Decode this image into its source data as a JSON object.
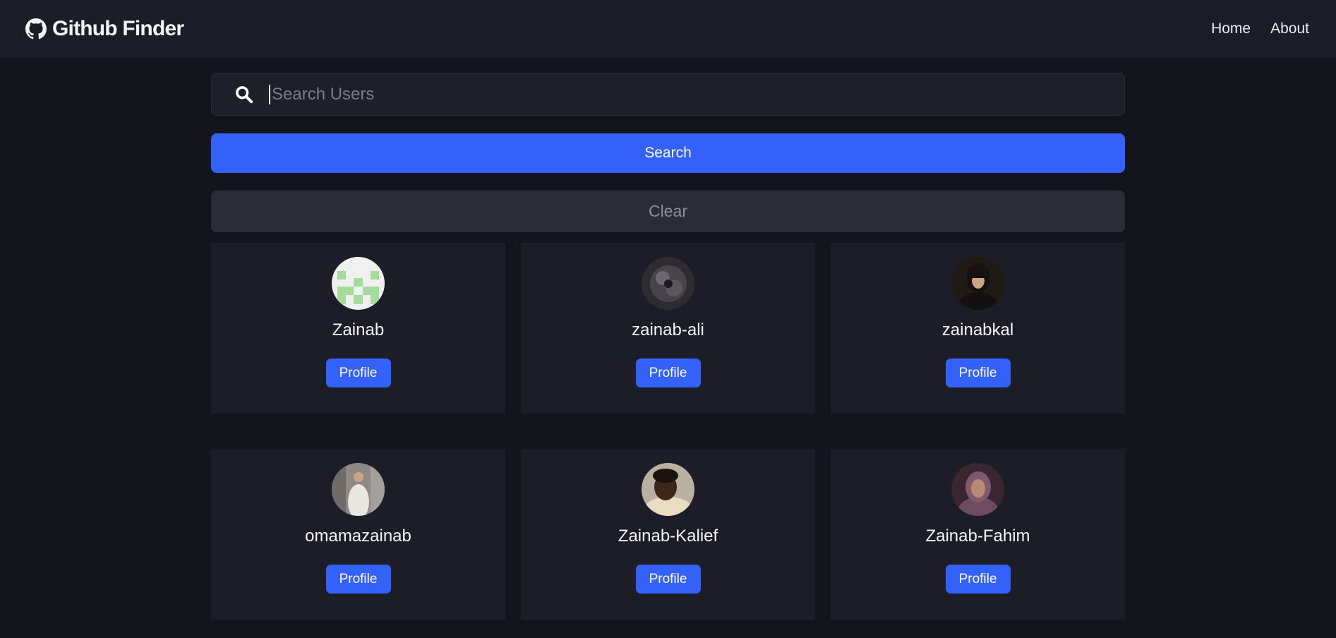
{
  "navbar": {
    "brand_icon": "github-icon",
    "brand_title": "Github Finder",
    "links": [
      "Home",
      "About"
    ]
  },
  "search": {
    "icon": "search-icon",
    "placeholder": "Search Users",
    "value": "",
    "search_label": "Search",
    "clear_label": "Clear"
  },
  "users": [
    {
      "login": "Zainab",
      "profile_label": "Profile"
    },
    {
      "login": "zainab-ali",
      "profile_label": "Profile"
    },
    {
      "login": "zainabkal",
      "profile_label": "Profile"
    },
    {
      "login": "omamazainab",
      "profile_label": "Profile"
    },
    {
      "login": "Zainab-Kalief",
      "profile_label": "Profile"
    },
    {
      "login": "Zainab-Fahim",
      "profile_label": "Profile"
    }
  ],
  "colors": {
    "background": "#13141c",
    "navbar": "#1c1d26",
    "card": "#1c1d26",
    "primary": "#3361fa",
    "clear_button": "#2b2c36"
  }
}
